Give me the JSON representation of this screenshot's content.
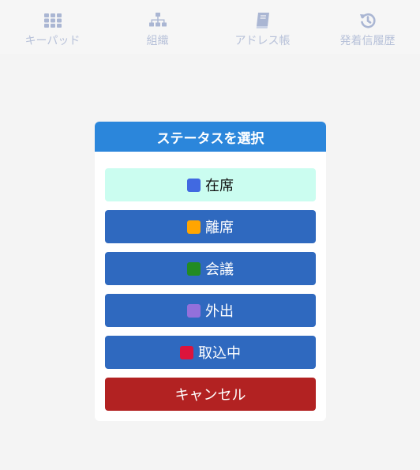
{
  "nav": {
    "items": [
      {
        "label": "キーパッド",
        "icon": "keypad-grid-icon"
      },
      {
        "label": "組織",
        "icon": "org-chart-icon"
      },
      {
        "label": "アドレス帳",
        "icon": "address-book-icon"
      },
      {
        "label": "発着信履歴",
        "icon": "history-icon"
      }
    ],
    "color": "#b2bdd6"
  },
  "dialog": {
    "title": "ステータスを選択",
    "header_color": "#2b86db",
    "statuses": [
      {
        "label": "在席",
        "color": "#4169e1",
        "selected": true
      },
      {
        "label": "離席",
        "color": "#ffa500",
        "selected": false
      },
      {
        "label": "会議",
        "color": "#228b22",
        "selected": false
      },
      {
        "label": "外出",
        "color": "#9370db",
        "selected": false
      },
      {
        "label": "取込中",
        "color": "#dc143c",
        "selected": false
      }
    ],
    "cancel_label": "キャンセル",
    "cancel_color": "#b22222"
  }
}
